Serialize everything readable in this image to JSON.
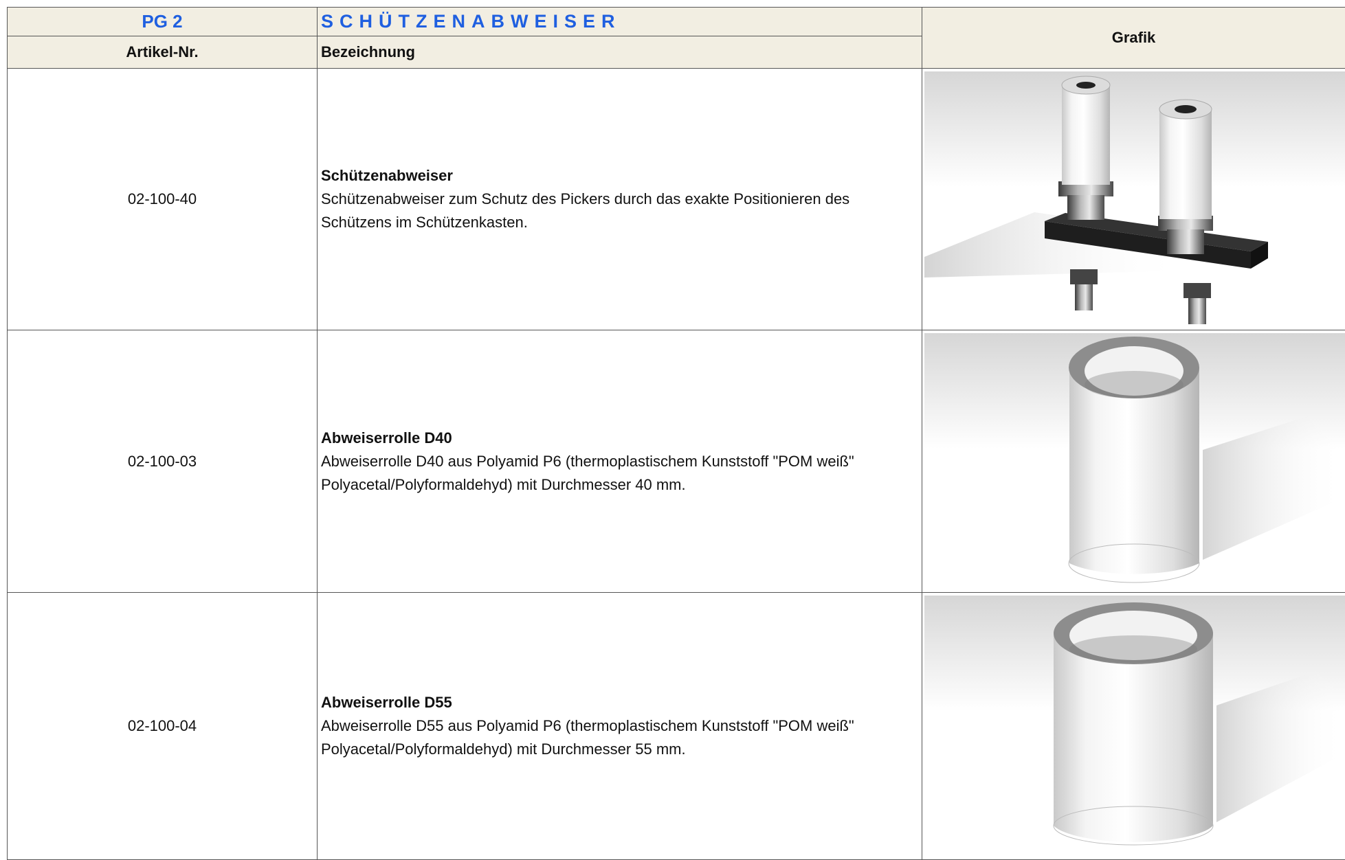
{
  "header": {
    "pg_label": "PG 2",
    "title": "SCHÜTZENABWEISER",
    "grafik_label": "Grafik",
    "col_artikel": "Artikel-Nr.",
    "col_bezeichnung": "Bezeichnung"
  },
  "rows": [
    {
      "artikel_nr": "02-100-40",
      "title": "Schützenabweiser",
      "description": "Schützenabweiser zum Schutz des Pickers durch das exakte Positionieren des Schützens im Schützenkasten.",
      "graphic_icon": "shuttle-deflector-assembly-image"
    },
    {
      "artikel_nr": "02-100-03",
      "title": "Abweiserrolle D40",
      "description": "Abweiserrolle D40 aus Polyamid P6 (thermoplastischem Kunststoff \"POM weiß\" Polyacetal/Polyformaldehyd) mit Durchmesser 40 mm.",
      "graphic_icon": "deflector-roller-d40-image"
    },
    {
      "artikel_nr": "02-100-04",
      "title": "Abweiserrolle D55",
      "description": "Abweiserrolle D55 aus Polyamid P6 (thermoplastischem Kunststoff \"POM weiß\" Polyacetal/Polyformaldehyd) mit Durchmesser 55 mm.",
      "graphic_icon": "deflector-roller-d55-image"
    }
  ]
}
